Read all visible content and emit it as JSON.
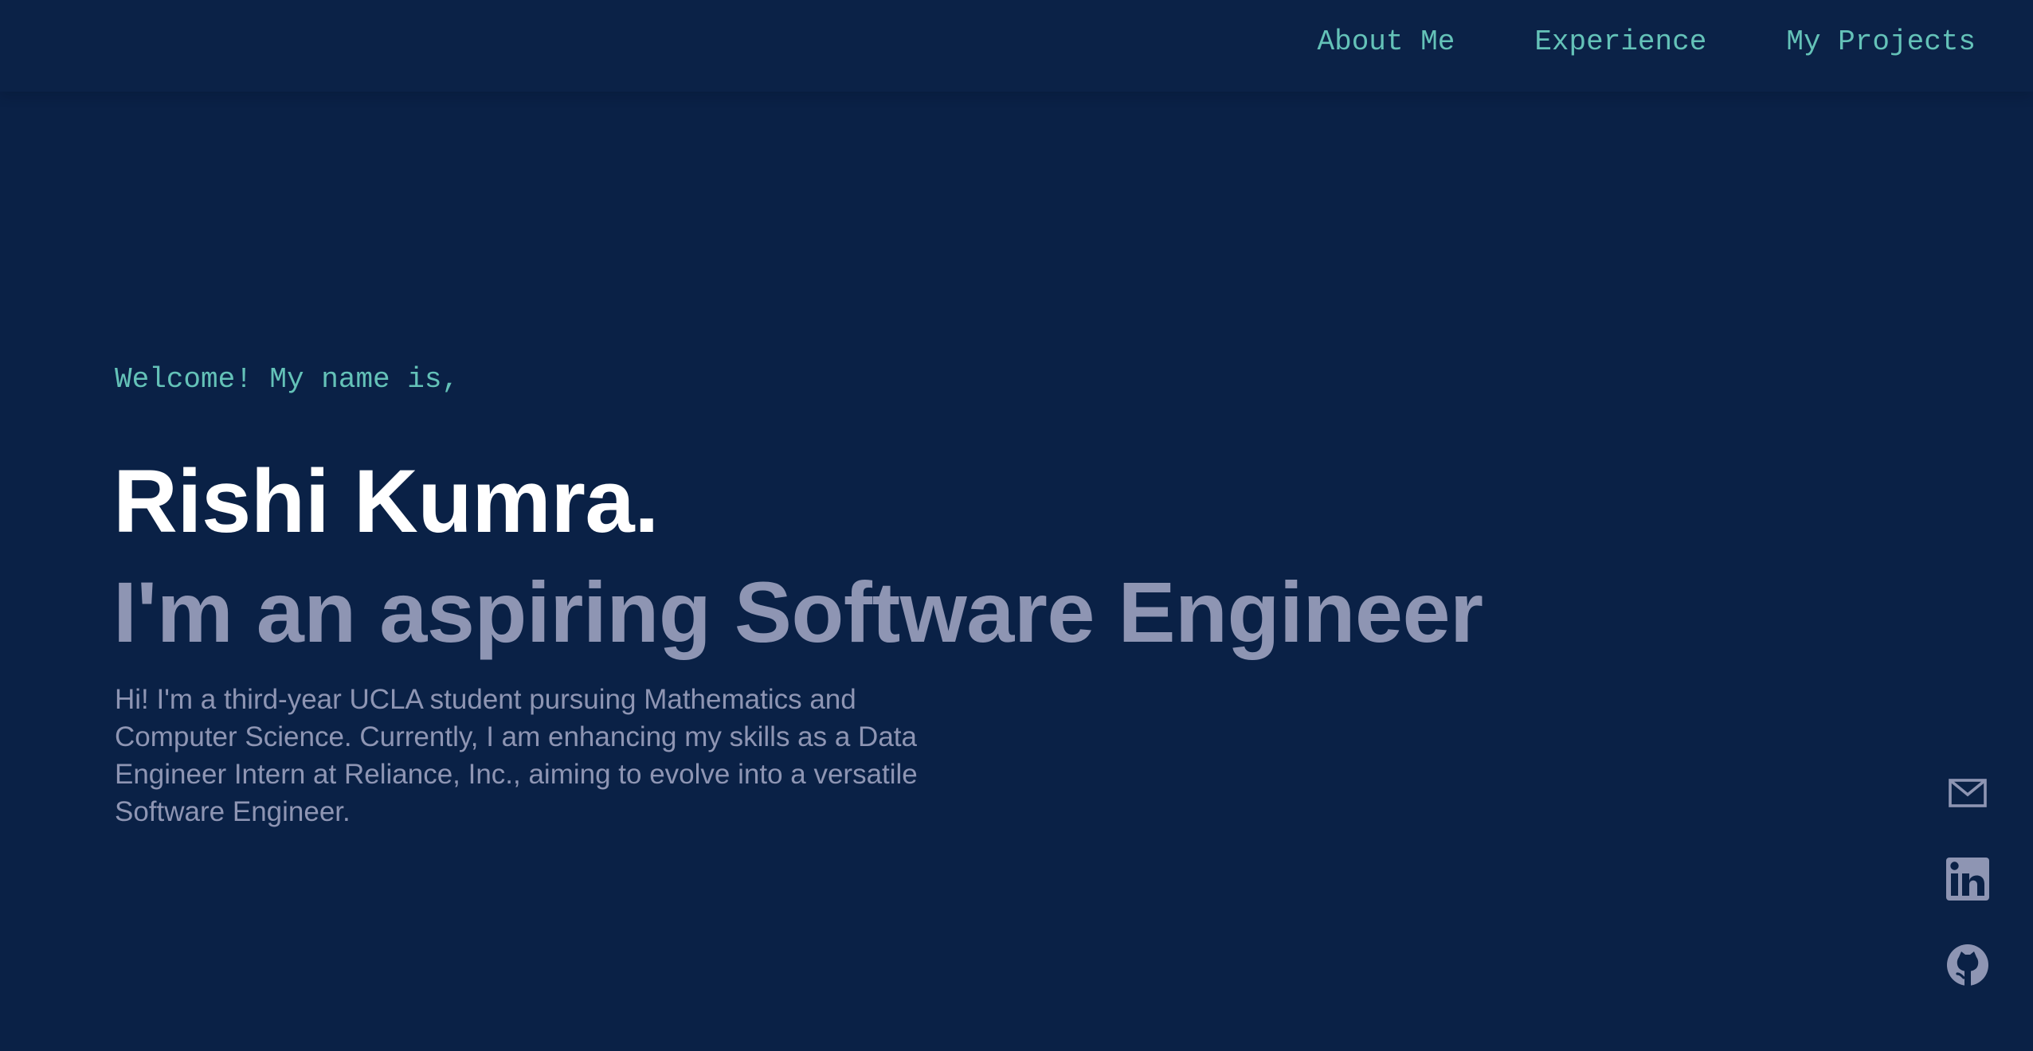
{
  "nav": {
    "items": [
      {
        "label": "About Me"
      },
      {
        "label": "Experience"
      },
      {
        "label": "My Projects"
      }
    ]
  },
  "hero": {
    "greeting": "Welcome! My name is,",
    "name": "Rishi Kumra.",
    "tagline": "I'm an aspiring Software Engineer",
    "bio": "Hi! I'm a third-year UCLA student pursuing Mathematics and Computer Science. Currently, I am enhancing my skills as a Data Engineer Intern at Reliance, Inc., aiming to evolve into a versatile Software Engineer."
  },
  "social": {
    "icons": [
      "mail-icon",
      "linkedin-icon",
      "github-icon"
    ]
  },
  "colors": {
    "background": "#0a2146",
    "accent": "#64c2b8",
    "heading": "#ffffff",
    "muted": "#8e95b3"
  }
}
